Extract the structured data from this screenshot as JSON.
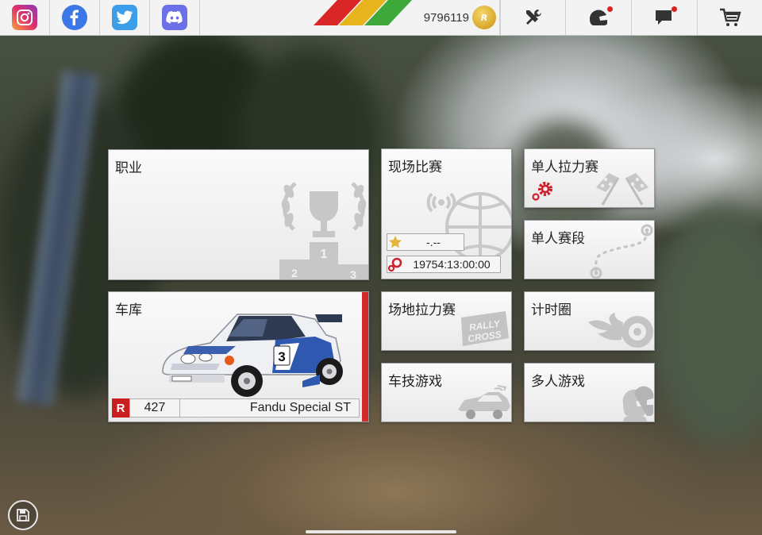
{
  "social": [
    {
      "name": "instagram-icon",
      "color": "#e1306c"
    },
    {
      "name": "facebook-icon",
      "color": "#3b77e7"
    },
    {
      "name": "twitter-icon",
      "color": "#3c9ee8"
    },
    {
      "name": "discord-icon",
      "color": "#6c70e8"
    }
  ],
  "currency": {
    "value": "9796119",
    "coin_label": "R"
  },
  "toolbar": {
    "tools": "tools-icon",
    "helmet": "helmet-icon",
    "messages": "messages-icon",
    "shop": "shop-cart-icon"
  },
  "tiles": {
    "career": {
      "label": "职业"
    },
    "live_event": {
      "label": "现场比赛",
      "star_value": "-.--",
      "timer": "19754:13:00:00"
    },
    "single_rally": {
      "label": "单人拉力赛"
    },
    "single_stage": {
      "label": "单人赛段"
    },
    "garage": {
      "label": "车库",
      "class_badge": "R",
      "car_number": "427",
      "car_name": "Fandu Special ST"
    },
    "rallycross": {
      "label": "场地拉力赛"
    },
    "time_attack": {
      "label": "计时圈"
    },
    "gymkhana": {
      "label": "车技游戏"
    },
    "multiplayer": {
      "label": "多人游戏"
    }
  },
  "decor": {
    "podium_numbers": [
      "1",
      "2",
      "3"
    ],
    "rallycross_logo": [
      "RALLY",
      "CROSS"
    ],
    "car_door_number": "3"
  }
}
